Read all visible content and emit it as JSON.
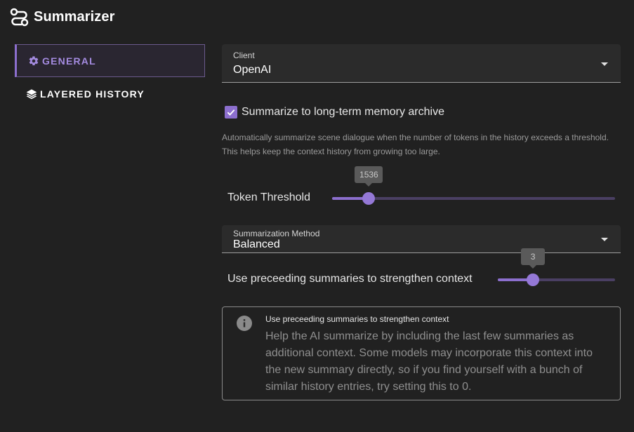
{
  "app": {
    "title": "Summarizer",
    "icon": "route-icon"
  },
  "nav": {
    "items": [
      {
        "label": "GENERAL",
        "icon": "gear-icon",
        "active": true
      },
      {
        "label": "LAYERED HISTORY",
        "icon": "layers-icon",
        "active": false
      }
    ]
  },
  "client": {
    "label": "Client",
    "value": "OpenAI"
  },
  "archive": {
    "checked": true,
    "label": "Summarize to long-term memory archive",
    "hint": "Automatically summarize scene dialogue when the number of tokens in the history exceeds a threshold. This helps keep the context history from growing too large."
  },
  "token_threshold": {
    "label": "Token Threshold",
    "value": "1536",
    "fraction": 0.13
  },
  "method": {
    "label": "Summarization Method",
    "value": "Balanced"
  },
  "preceeding": {
    "label": "Use preceeding summaries to strengthen context",
    "value": "3",
    "fraction": 0.3
  },
  "info": {
    "title": "Use preceeding summaries to strengthen context",
    "body": "Help the AI summarize by including the last few summaries as additional context. Some models may incorporate this context into the new summary directly, so if you find yourself with a bunch of similar history entries, try setting this to 0."
  },
  "colors": {
    "accent": "#8c6fce",
    "background": "#212121",
    "surface": "#2b2b2b"
  }
}
